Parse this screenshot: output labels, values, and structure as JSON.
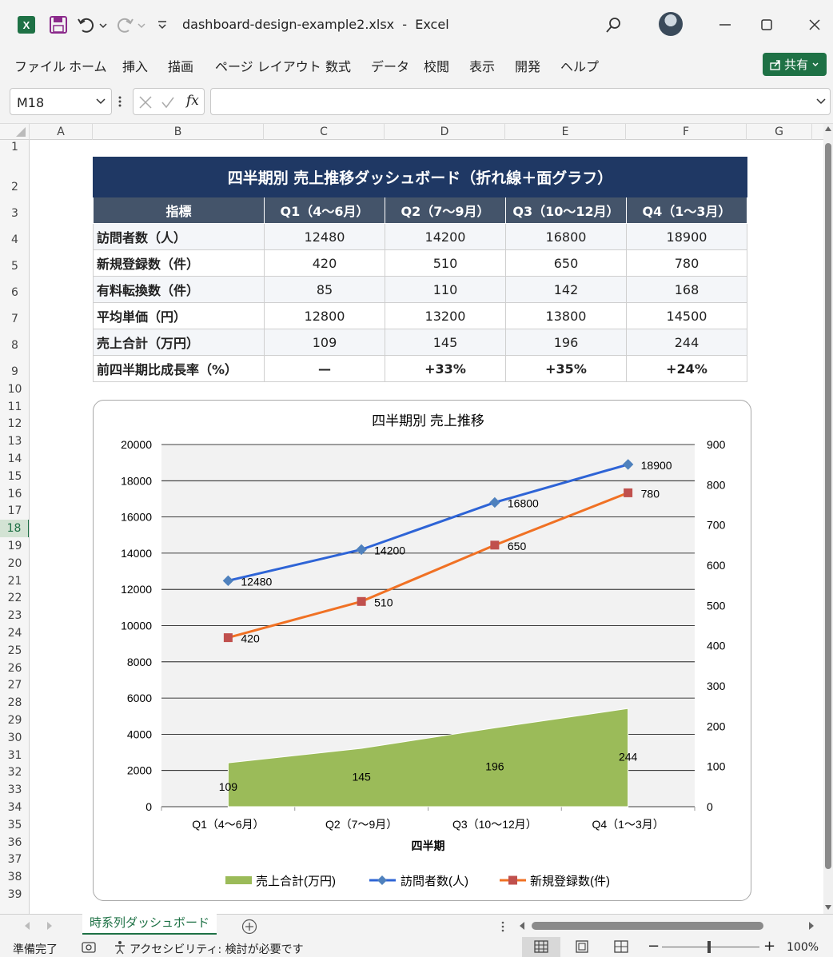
{
  "window": {
    "filename": "dashboard-design-example2.xlsx",
    "separator": "-",
    "app_name": "Excel",
    "app_icon": "excel-icon",
    "share_label": "共有"
  },
  "menu": [
    "ファイル",
    "ホーム",
    "挿入",
    "描画",
    "ページ レイアウト",
    "数式",
    "データ",
    "校閲",
    "表示",
    "開発",
    "ヘルプ"
  ],
  "formula_bar": {
    "name_box": "M18",
    "fx_label": "fx",
    "formula": ""
  },
  "columns": [
    "A",
    "B",
    "C",
    "D",
    "E",
    "F",
    "G"
  ],
  "rows": [
    "1",
    "2",
    "3",
    "4",
    "5",
    "6",
    "7",
    "8",
    "9",
    "10",
    "11",
    "12",
    "13",
    "14",
    "15",
    "16",
    "17",
    "18",
    "19",
    "20",
    "21",
    "22",
    "23",
    "24",
    "25",
    "26",
    "27",
    "28",
    "29",
    "30",
    "31",
    "32",
    "33",
    "34",
    "35",
    "36",
    "37",
    "38",
    "39"
  ],
  "selected_row": "18",
  "table": {
    "title": "四半期別 売上推移ダッシュボード（折れ線＋面グラフ）",
    "headers": [
      "指標",
      "Q1（4〜6月）",
      "Q2（7〜9月）",
      "Q3（10〜12月）",
      "Q4（1〜3月）"
    ],
    "rows": [
      [
        "訪問者数（人）",
        "12480",
        "14200",
        "16800",
        "18900"
      ],
      [
        "新規登録数（件）",
        "420",
        "510",
        "650",
        "780"
      ],
      [
        "有料転換数（件）",
        "85",
        "110",
        "142",
        "168"
      ],
      [
        "平均単価（円）",
        "12800",
        "13200",
        "13800",
        "14500"
      ],
      [
        "売上合計（万円）",
        "109",
        "145",
        "196",
        "244"
      ],
      [
        "前四半期比成長率（%）",
        "—",
        "+33%",
        "+35%",
        "+24%"
      ]
    ]
  },
  "chart_data": {
    "type": "line",
    "title": "四半期別 売上推移",
    "xlabel": "四半期",
    "ylabel": "",
    "categories": [
      "Q1（4〜6月）",
      "Q2（7〜9月）",
      "Q3（10〜12月）",
      "Q4（1〜3月）"
    ],
    "ylim": [
      0,
      20000
    ],
    "y_ticks": [
      "0",
      "2000",
      "4000",
      "6000",
      "8000",
      "10000",
      "12000",
      "14000",
      "16000",
      "18000",
      "20000"
    ],
    "y2lim": [
      0,
      900
    ],
    "y2_ticks": [
      "0",
      "100",
      "200",
      "300",
      "400",
      "500",
      "600",
      "700",
      "800",
      "900"
    ],
    "grid": true,
    "legend_position": "bottom",
    "series": [
      {
        "name": "売上合計(万円)",
        "type": "area",
        "axis": "secondary",
        "color": "#9bbb59",
        "values": [
          109,
          145,
          196,
          244
        ],
        "labels": [
          "109",
          "145",
          "196",
          "244"
        ]
      },
      {
        "name": "訪問者数(人)",
        "type": "line",
        "axis": "primary",
        "marker": "diamond",
        "color": "#2e64d6",
        "values": [
          12480,
          14200,
          16800,
          18900
        ],
        "labels": [
          "12480",
          "14200",
          "16800",
          "18900"
        ]
      },
      {
        "name": "新規登録数(件)",
        "type": "line",
        "axis": "secondary",
        "marker": "square",
        "color": "#f07124",
        "marker_color": "#c0504d",
        "values": [
          420,
          510,
          650,
          780
        ],
        "labels": [
          "420",
          "510",
          "650",
          "780"
        ]
      }
    ]
  },
  "sheet_tab": "時系列ダッシュボード",
  "status": {
    "ready": "準備完了",
    "accessibility": "アクセシビリティ: 検討が必要です",
    "zoom": "100%"
  },
  "colors": {
    "excel_green": "#1e7145",
    "table_title_bg": "#1f3864",
    "table_header_bg": "#44546a"
  }
}
